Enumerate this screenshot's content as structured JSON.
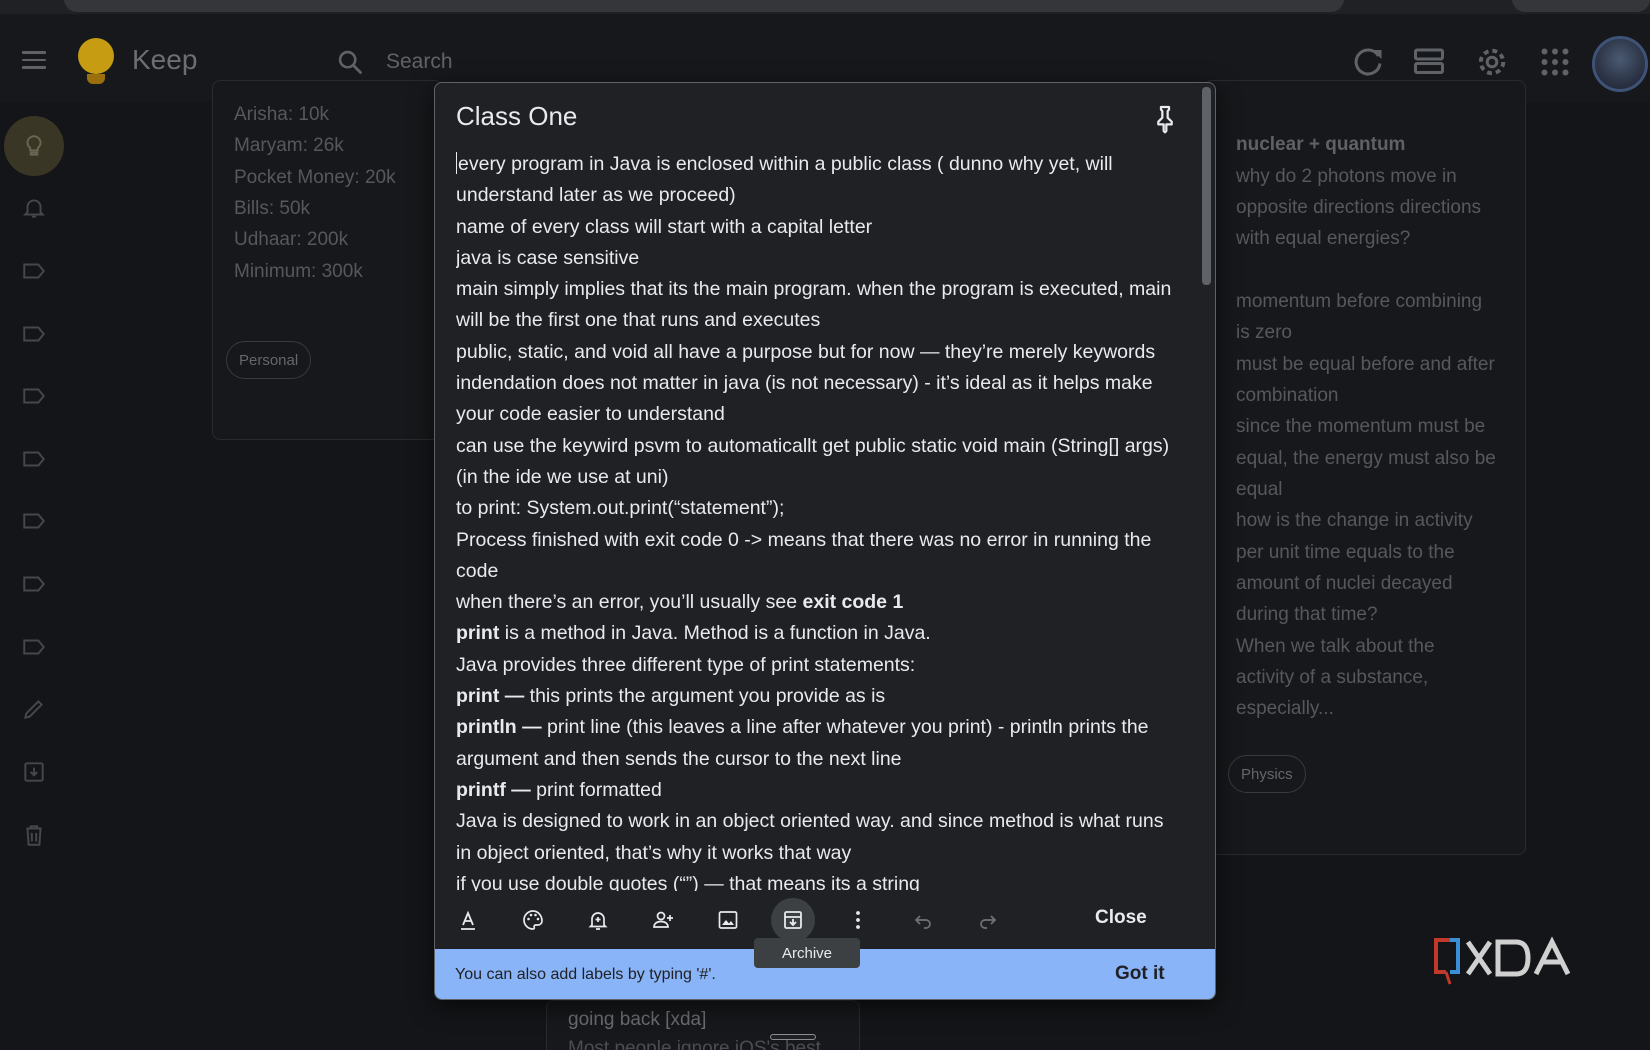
{
  "app": {
    "name": "Keep"
  },
  "header": {
    "search_placeholder": "Search"
  },
  "background_notes": {
    "left": {
      "lines": [
        "Arisha: 10k",
        "Maryam: 26k",
        "Pocket Money: 20k",
        "Bills: 50k",
        "Udhaar: 200k",
        "Minimum: 300k"
      ],
      "label": "Personal"
    },
    "right": {
      "title": "nuclear + quantum",
      "lines": [
        "why do 2 photons move in",
        "opposite directions directions",
        "with equal energies?",
        "",
        "momentum before combining",
        "is zero",
        "must be equal before and after",
        "combination",
        "since the momentum must be",
        "equal, the energy must also be",
        "equal",
        "how is the change in activity",
        "per unit time equals to the",
        "amount of nuclei decayed",
        "during that time?",
        "When we talk about the",
        "activity of a substance,",
        "especially..."
      ],
      "label": "Physics"
    },
    "bottom": {
      "title": "going back [xda]",
      "preview": "Most people ignore iOS's best"
    }
  },
  "note": {
    "title": "Class One",
    "lines": [
      {
        "pre": "every program in Java is enclosed within a public class ( dunno why yet, will",
        "b": "",
        "post": ""
      },
      {
        "pre": "understand later as we proceed)",
        "b": "",
        "post": ""
      },
      {
        "pre": "name of every class will start with a capital letter",
        "b": "",
        "post": ""
      },
      {
        "pre": "java is case sensitive",
        "b": "",
        "post": ""
      },
      {
        "pre": "main simply implies that its the main program. when the program is executed, main",
        "b": "",
        "post": ""
      },
      {
        "pre": "will be the first one that runs and executes",
        "b": "",
        "post": ""
      },
      {
        "pre": "public, static, and void all have a purpose but for now — they’re merely keywords",
        "b": "",
        "post": ""
      },
      {
        "pre": "indendation does not matter in java (is not necessary) - it’s ideal as it helps make",
        "b": "",
        "post": ""
      },
      {
        "pre": "your code easier to understand",
        "b": "",
        "post": ""
      },
      {
        "pre": "can use the keywird psvm to automaticallt get public static void main (String[] args)",
        "b": "",
        "post": ""
      },
      {
        "pre": "(in the ide we use at uni)",
        "b": "",
        "post": ""
      },
      {
        "pre": "to print: System.out.print(“statement”);",
        "b": "",
        "post": ""
      },
      {
        "pre": "Process finished with exit code 0 -> means that there was no error in running the",
        "b": "",
        "post": ""
      },
      {
        "pre": "code",
        "b": "",
        "post": ""
      },
      {
        "pre": "when there’s an error, you’ll usually see ",
        "b": "exit code 1",
        "post": ""
      },
      {
        "pre": "",
        "b": "print",
        "post": " is a method in Java. Method is a function in Java."
      },
      {
        "pre": "Java provides three different type of print statements:",
        "b": "",
        "post": ""
      },
      {
        "pre": "",
        "b": "print —",
        "post": " this prints the argument you provide as is"
      },
      {
        "pre": "",
        "b": "println —",
        "post": " print line (this leaves a line after whatever you print) - println prints the"
      },
      {
        "pre": "argument and then sends the cursor to the next line",
        "b": "",
        "post": ""
      },
      {
        "pre": "",
        "b": "printf —",
        "post": " print formatted"
      },
      {
        "pre": "Java is designed to work in an object oriented way. and since method is what runs",
        "b": "",
        "post": ""
      },
      {
        "pre": "in object oriented, that’s why it works that way",
        "b": "",
        "post": ""
      },
      {
        "pre": "if you use double quotes (“”) — that means its a string",
        "b": "",
        "post": ""
      }
    ]
  },
  "toolbar": {
    "close_label": "Close",
    "archive_tooltip": "Archive",
    "icons": [
      "text-format-icon",
      "palette-icon",
      "reminder-icon",
      "collaborator-icon",
      "image-icon",
      "archive-icon",
      "more-icon",
      "undo-icon",
      "redo-icon"
    ]
  },
  "info_bar": {
    "text": "You can also add labels by typing '#'.",
    "action": "Got it"
  },
  "colors": {
    "accent": "#8ab4f8",
    "background": "#141518",
    "modal": "#202124",
    "keep_yellow": "#c69c13"
  }
}
